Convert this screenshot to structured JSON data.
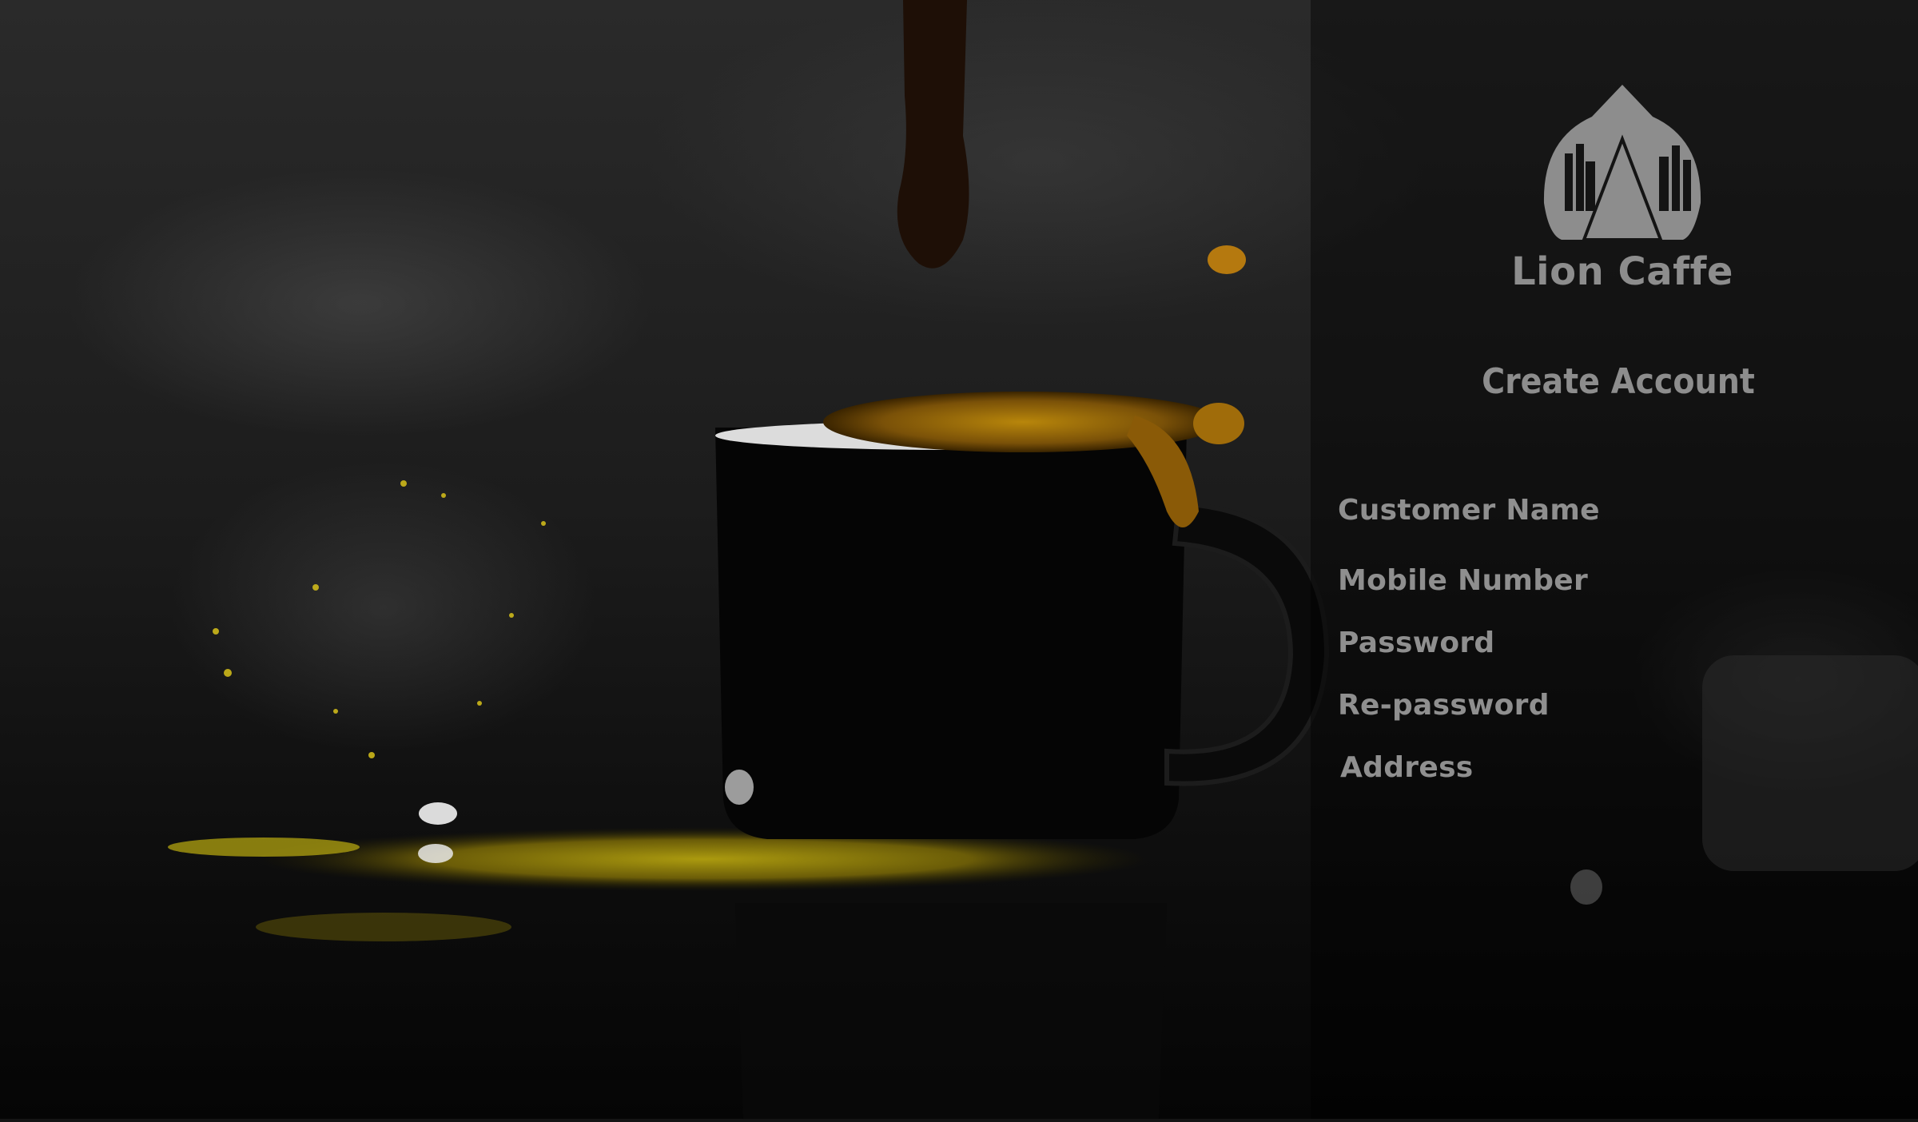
{
  "brand": {
    "name": "Lion Caffe",
    "logo_icon": "lion-caffe-logo-icon"
  },
  "form": {
    "title": "Create Account",
    "fields": [
      {
        "label": "Customer Name",
        "value": ""
      },
      {
        "label": "Mobile Number",
        "value": ""
      },
      {
        "label": "Password",
        "value": ""
      },
      {
        "label": "Re-password",
        "value": ""
      },
      {
        "label": "Address",
        "value": ""
      }
    ]
  },
  "colors": {
    "text": "#8f8f8f",
    "panel": "#000000",
    "accent": "#c8a11a"
  }
}
